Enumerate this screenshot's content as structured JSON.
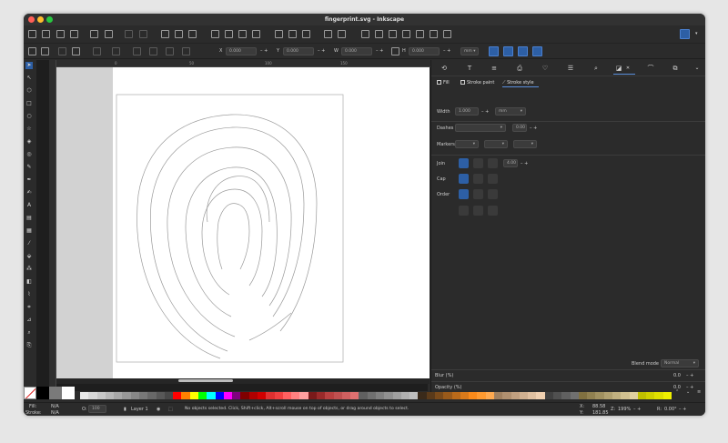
{
  "window": {
    "title": "fingerprint.svg - Inkscape"
  },
  "controls": {
    "x_label": "X",
    "x_value": "0.000",
    "y_label": "Y",
    "y_value": "0.000",
    "w_label": "W",
    "w_value": "0.000",
    "h_label": "H",
    "h_value": "0.000",
    "unit": "mm"
  },
  "rulers": {
    "h_ticks": [
      "0",
      "50",
      "100",
      "150"
    ]
  },
  "dock": {
    "tabs": [
      "fill-stroke-tab-icon"
    ],
    "subtabs": {
      "fill": "Fill",
      "stroke_paint": "Stroke paint",
      "stroke_style": "Stroke style"
    },
    "width_label": "Width",
    "width_value": "1.000",
    "width_unit": "mm",
    "dashes_label": "Dashes",
    "dashes_value": "0.00",
    "markers_label": "Markers",
    "join_label": "Join",
    "join_value": "4.00",
    "cap_label": "Cap",
    "order_label": "Order",
    "blend_label": "Blend mode",
    "blend_value": "Normal",
    "blur_label": "Blur (%)",
    "blur_value": "0.0",
    "opacity_label": "Opacity (%)",
    "opacity_value": "0.0"
  },
  "status": {
    "fill_label": "Fill:",
    "fill_value": "N/A",
    "stroke_label": "Stroke:",
    "stroke_value": "N/A",
    "opacity_label": "O:",
    "opacity_value": "100",
    "layer": "Layer 1",
    "message": "No objects selected. Click, Shift+click, Alt+scroll mouse on top of objects, or drag around objects to select.",
    "x_label": "X:",
    "x_value": "88.58",
    "y_label": "Y:",
    "y_value": "181.85",
    "zoom_label": "Z:",
    "zoom_value": "199%",
    "rot_label": "R:",
    "rot_value": "0.00°"
  },
  "colors": {
    "accent": "#2d5fa5",
    "canvas_bg": "#d2d2d2",
    "page": "#ffffff"
  }
}
